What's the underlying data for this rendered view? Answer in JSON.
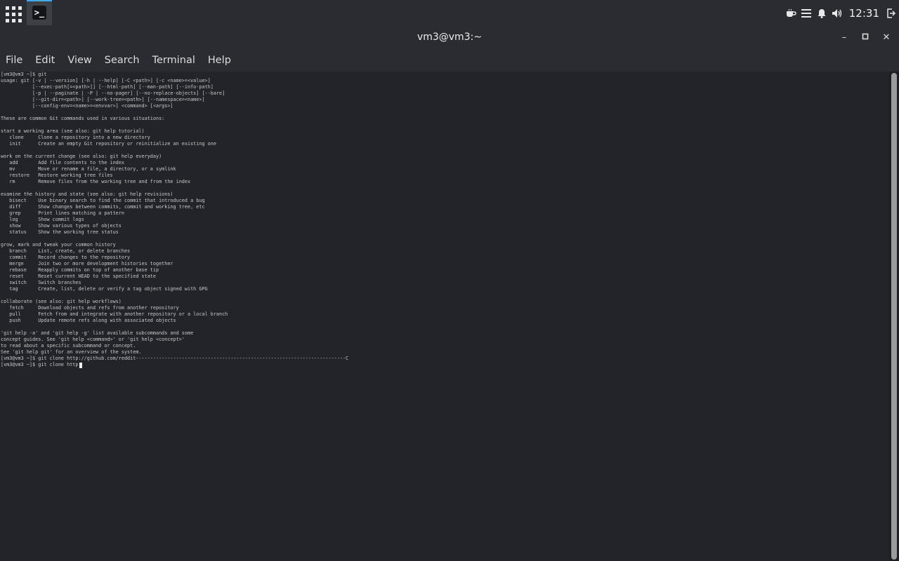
{
  "topbar": {
    "clock": "12:31",
    "tray_icons": [
      "caffeine-icon",
      "menu-lines-icon",
      "bell-icon",
      "volume-icon",
      "logout-icon"
    ]
  },
  "window": {
    "title": "vm3@vm3:~",
    "minimize_symbol": "–",
    "maximize_symbol": "▫",
    "close_symbol": "✕"
  },
  "menu": {
    "items": [
      "File",
      "Edit",
      "View",
      "Search",
      "Terminal",
      "Help"
    ]
  },
  "terminal": {
    "output": "[vm3@vm3 ~]$ git\nusage: git [-v | --version] [-h | --help] [-C <path>] [-c <name>=<value>]\n           [--exec-path[=<path>]] [--html-path] [--man-path] [--info-path]\n           [-p | --paginate | -P | --no-pager] [--no-replace-objects] [--bare]\n           [--git-dir=<path>] [--work-tree=<path>] [--namespace=<name>]\n           [--config-env=<name>=<envvar>] <command> [<args>]\n\nThese are common Git commands used in various situations:\n\nstart a working area (see also: git help tutorial)\n   clone     Clone a repository into a new directory\n   init      Create an empty Git repository or reinitialize an existing one\n\nwork on the current change (see also: git help everyday)\n   add       Add file contents to the index\n   mv        Move or rename a file, a directory, or a symlink\n   restore   Restore working tree files\n   rm        Remove files from the working tree and from the index\n\nexamine the history and state (see also: git help revisions)\n   bisect    Use binary search to find the commit that introduced a bug\n   diff      Show changes between commits, commit and working tree, etc\n   grep      Print lines matching a pattern\n   log       Show commit logs\n   show      Show various types of objects\n   status    Show the working tree status\n\ngrow, mark and tweak your common history\n   branch    List, create, or delete branches\n   commit    Record changes to the repository\n   merge     Join two or more development histories together\n   rebase    Reapply commits on top of another base tip\n   reset     Reset current HEAD to the specified state\n   switch    Switch branches\n   tag       Create, list, delete or verify a tag object signed with GPG\n\ncollaborate (see also: git help workflows)\n   fetch     Download objects and refs from another repository\n   pull      Fetch from and integrate with another repository or a local branch\n   push      Update remote refs along with associated objects\n\n'git help -a' and 'git help -g' list available subcommands and some\nconcept guides. See 'git help <command>' or 'git help <concept>'\nto read about a specific subcommand or concept.\nSee 'git help git' for an overview of the system.\n[vm3@vm3 ~]$ git clone http://github.com/reddit-------------------------------------------------------------------------C",
    "prompt_line": "[vm3@vm3 ~]$ git clone http"
  },
  "colors": {
    "terminal_bg": "#232429",
    "chrome_bg": "#2b2c31",
    "text": "#c8c8c8",
    "active_task_accent": "#3daee9"
  }
}
